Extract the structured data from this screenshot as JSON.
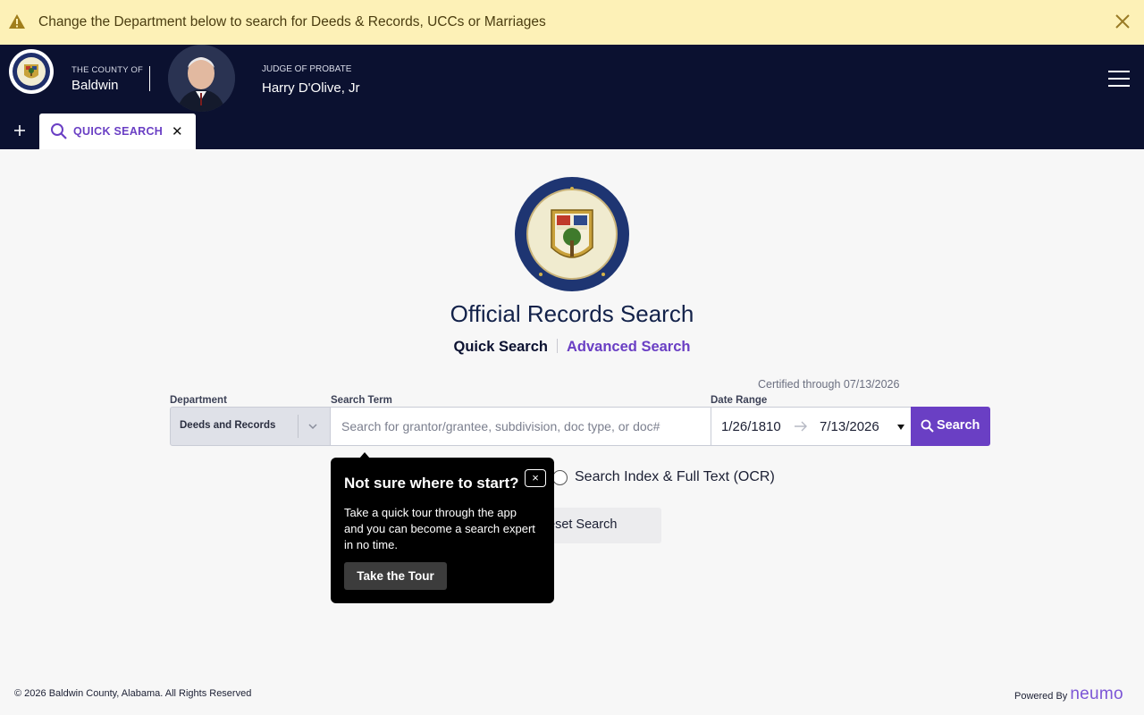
{
  "banner": {
    "message": "Change the Department below to search for Deeds & Records, UCCs or Marriages",
    "icon": "warning-icon",
    "accent": "#fdf1b7"
  },
  "header": {
    "county_sub": "THE COUNTY OF",
    "county_name": "Baldwin",
    "judge_sub": "JUDGE OF PROBATE",
    "judge_name": "Harry D'Olive, Jr",
    "bg": "#0b1130"
  },
  "tabs": [
    {
      "label": "QUICK SEARCH",
      "active": true
    }
  ],
  "main": {
    "title": "Official Records Search",
    "modes": {
      "quick": "Quick Search",
      "advanced": "Advanced Search"
    },
    "certified": "Certified through 07/13/2026"
  },
  "form": {
    "department_label": "Department",
    "department_value": "Deeds and Records",
    "search_label": "Search Term",
    "search_placeholder": "Search for grantor/grantee, subdivision, doc type, or doc#",
    "date_label": "Date Range",
    "date_from": "1/26/1810",
    "date_to": "7/13/2026",
    "search_button": "Search",
    "ocr_label": "Search Index & Full Text (OCR)",
    "reset_label": "eset Search"
  },
  "tour": {
    "title": "Not sure where to start?",
    "body": "Take a quick tour through the app and you can become a search expert in no time.",
    "button": "Take the Tour",
    "close": "×"
  },
  "footer": {
    "copyright": "© 2026 Baldwin County, Alabama. All Rights Reserved",
    "powered": "Powered By",
    "brand": "neumo",
    "brand_color": "#7c55d6"
  }
}
